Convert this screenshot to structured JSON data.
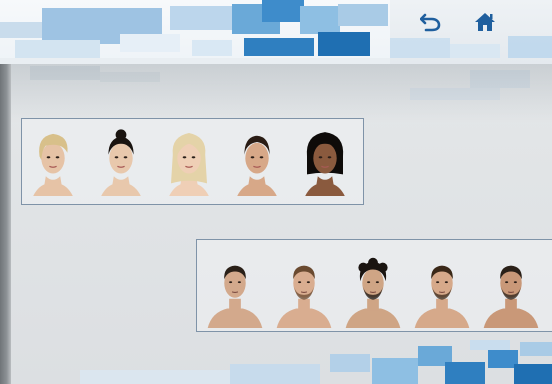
{
  "toolbar": {
    "back": {
      "icon": "back-arrow-icon"
    },
    "home": {
      "icon": "home-icon"
    }
  },
  "colors": {
    "accent_blue": "#1f5f9e",
    "tile_light": "#a9cbe6",
    "tile_mid": "#6aa9d8",
    "tile_dark": "#2f7fc0",
    "strip_border": "#7f93a8"
  },
  "face_groups": {
    "women": {
      "count": 5,
      "faces": [
        {
          "hair": "#d8c08a",
          "skin": "#e6c3a6",
          "style": "short-blonde"
        },
        {
          "hair": "#1a1410",
          "skin": "#e8c8ac",
          "style": "dark-bun"
        },
        {
          "hair": "#e4d3a8",
          "skin": "#efcfb6",
          "style": "long-blonde"
        },
        {
          "hair": "#2a1c14",
          "skin": "#d7a888",
          "style": "dark-pulled-back"
        },
        {
          "hair": "#0e0b09",
          "skin": "#8a5a3e",
          "style": "black-bob"
        }
      ]
    },
    "men": {
      "count": 5,
      "faces": [
        {
          "hair": "#2a2018",
          "skin": "#d3a98c",
          "style": "short-dark"
        },
        {
          "hair": "#6a4a30",
          "skin": "#d9ad90",
          "style": "buzz-brown"
        },
        {
          "hair": "#1a1410",
          "skin": "#cfa585",
          "style": "curly-dark"
        },
        {
          "hair": "#3a2818",
          "skin": "#d6a98a",
          "style": "short-dark-beard"
        },
        {
          "hair": "#2a2018",
          "skin": "#c99878",
          "style": "dark-beard"
        }
      ]
    }
  }
}
